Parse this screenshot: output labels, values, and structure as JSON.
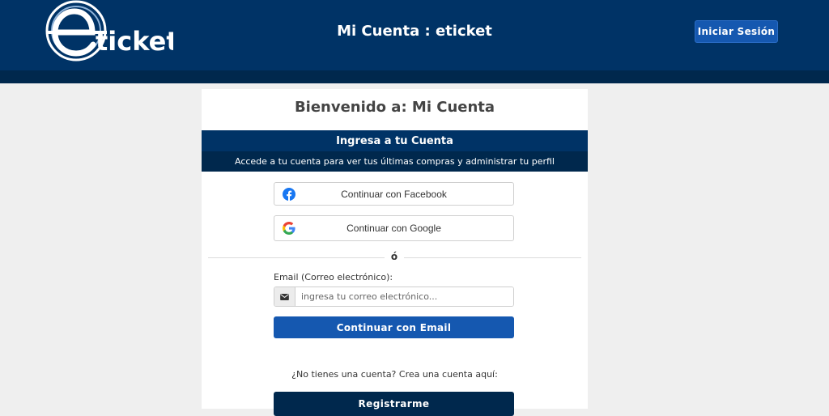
{
  "header": {
    "logo_text": "eticket",
    "title": "Mi Cuenta : eticket",
    "login_label": "Iniciar Sesión"
  },
  "card": {
    "welcome": "Bienvenido a: Mi Cuenta",
    "section_title": "Ingresa a tu Cuenta",
    "section_subtitle": "Accede a tu cuenta para ver tus últimas compras y administrar tu perfil",
    "facebook_label": "Continuar con Facebook",
    "google_label": "Continuar con Google",
    "divider": "ó",
    "email_label": "Email (Correo electrónico):",
    "email_placeholder": "ingresa tu correo electrónico...",
    "email_value": "",
    "email_button": "Continuar con Email",
    "no_account_text": "¿No tienes una cuenta? Crea una cuenta aquí:",
    "register_button": "Registrarme"
  },
  "icons": {
    "logo": "eticket-logo",
    "facebook": "facebook-icon",
    "google": "google-icon",
    "email": "envelope-icon"
  },
  "colors": {
    "header_bg": "#003366",
    "header_dark": "#00284d",
    "primary_button": "#1558b0",
    "page_bg": "#efefef"
  }
}
